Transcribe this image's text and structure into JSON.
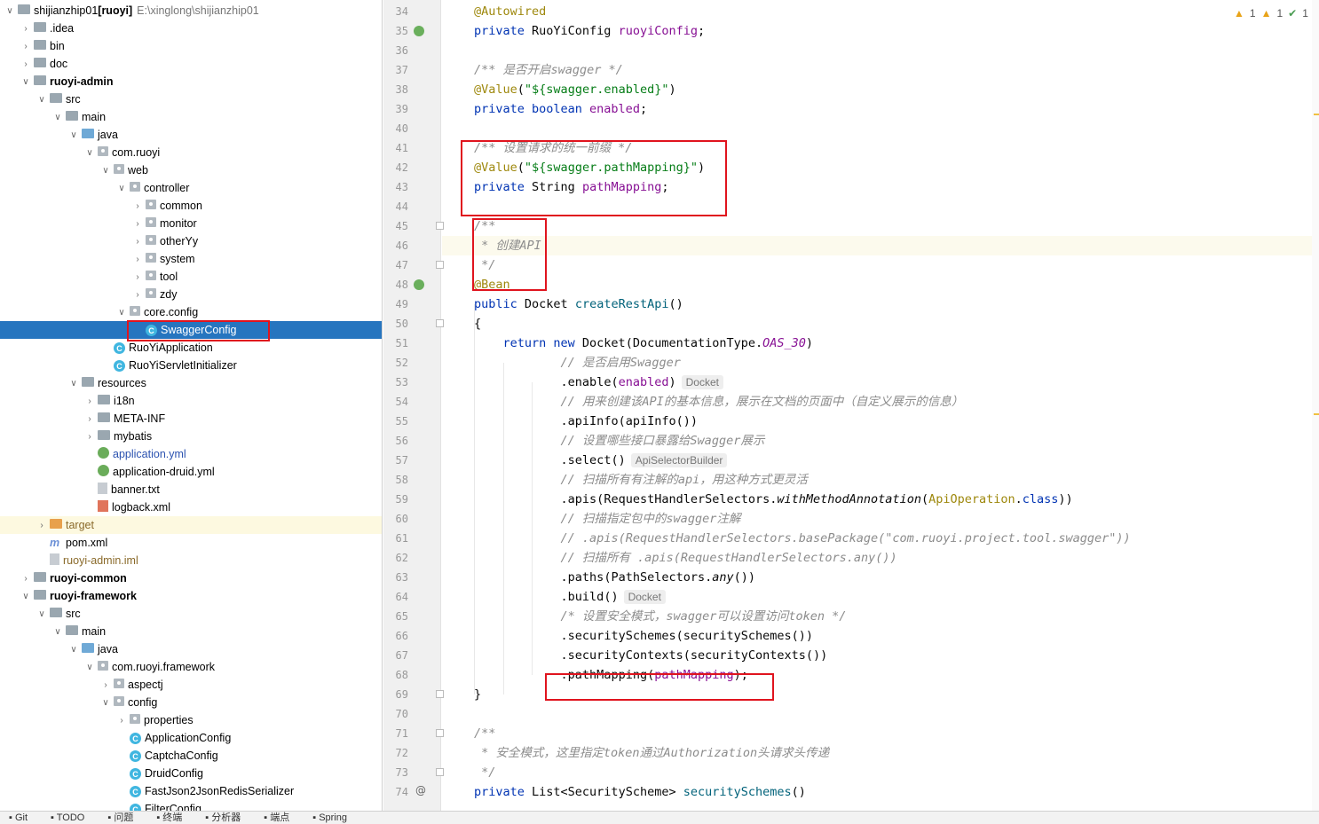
{
  "project_tree": {
    "root": {
      "name": "shijianzhip01",
      "tag": "[ruoyi]",
      "path": "E:\\xinglong\\shijianzhip01"
    },
    "items": [
      {
        "label": ".idea",
        "kind": "folder"
      },
      {
        "label": "bin",
        "kind": "folder"
      },
      {
        "label": "doc",
        "kind": "folder"
      },
      {
        "label": "ruoyi-admin",
        "kind": "module"
      },
      {
        "label": "src",
        "kind": "folder"
      },
      {
        "label": "main",
        "kind": "folder"
      },
      {
        "label": "java",
        "kind": "folder"
      },
      {
        "label": "com.ruoyi",
        "kind": "package"
      },
      {
        "label": "web",
        "kind": "package"
      },
      {
        "label": "controller",
        "kind": "package"
      },
      {
        "label": "common",
        "kind": "package"
      },
      {
        "label": "monitor",
        "kind": "package"
      },
      {
        "label": "otherYy",
        "kind": "package"
      },
      {
        "label": "system",
        "kind": "package"
      },
      {
        "label": "tool",
        "kind": "package"
      },
      {
        "label": "zdy",
        "kind": "package"
      },
      {
        "label": "core.config",
        "kind": "package"
      },
      {
        "label": "SwaggerConfig",
        "kind": "class"
      },
      {
        "label": "RuoYiApplication",
        "kind": "class"
      },
      {
        "label": "RuoYiServletInitializer",
        "kind": "class"
      },
      {
        "label": "resources",
        "kind": "folder"
      },
      {
        "label": "i18n",
        "kind": "folder"
      },
      {
        "label": "META-INF",
        "kind": "folder"
      },
      {
        "label": "mybatis",
        "kind": "folder"
      },
      {
        "label": "application.yml",
        "kind": "yml"
      },
      {
        "label": "application-druid.yml",
        "kind": "yml"
      },
      {
        "label": "banner.txt",
        "kind": "file"
      },
      {
        "label": "logback.xml",
        "kind": "xml"
      },
      {
        "label": "target",
        "kind": "folder"
      },
      {
        "label": "pom.xml",
        "kind": "maven"
      },
      {
        "label": "ruoyi-admin.iml",
        "kind": "file"
      },
      {
        "label": "ruoyi-common",
        "kind": "module"
      },
      {
        "label": "ruoyi-framework",
        "kind": "module"
      },
      {
        "label": "src",
        "kind": "folder"
      },
      {
        "label": "main",
        "kind": "folder"
      },
      {
        "label": "java",
        "kind": "folder"
      },
      {
        "label": "com.ruoyi.framework",
        "kind": "package"
      },
      {
        "label": "aspectj",
        "kind": "package"
      },
      {
        "label": "config",
        "kind": "package"
      },
      {
        "label": "properties",
        "kind": "package"
      },
      {
        "label": "ApplicationConfig",
        "kind": "class"
      },
      {
        "label": "CaptchaConfig",
        "kind": "class"
      },
      {
        "label": "DruidConfig",
        "kind": "class"
      },
      {
        "label": "FastJson2JsonRedisSerializer",
        "kind": "class"
      },
      {
        "label": "FilterConfig",
        "kind": "class"
      }
    ]
  },
  "inspection": {
    "warnings_a": "1",
    "warnings_b": "1",
    "ok": "1"
  },
  "editor": {
    "line_numbers": [
      "34",
      "35",
      "36",
      "37",
      "38",
      "39",
      "40",
      "41",
      "42",
      "43",
      "44",
      "45",
      "46",
      "47",
      "48",
      "49",
      "50",
      "51",
      "52",
      "53",
      "54",
      "55",
      "56",
      "57",
      "58",
      "59",
      "60",
      "61",
      "62",
      "63",
      "64",
      "65",
      "66",
      "67",
      "68",
      "69",
      "70",
      "71",
      "72",
      "73",
      "74"
    ],
    "hints": {
      "docket": "Docket",
      "api_selector": "ApiSelectorBuilder"
    },
    "tokens": {
      "l34_a": "@Autowired",
      "l35_kw": "private ",
      "l35_t": "RuoYiConfig ",
      "l35_f": "ruoyiConfig",
      "l35_e": ";",
      "l37": "/** 是否开启swagger */",
      "l38_a": "@Value",
      "l38_p": "(",
      "l38_s": "\"${swagger.enabled}\"",
      "l38_e": ")",
      "l39_kw": "private boolean ",
      "l39_f": "enabled",
      "l39_e": ";",
      "l41": "/** 设置请求的统一前缀 */",
      "l42_a": "@Value",
      "l42_p": "(",
      "l42_s": "\"${swagger.pathMapping}\"",
      "l42_e": ")",
      "l43_kw": "private ",
      "l43_t": "String ",
      "l43_f": "pathMapping",
      "l43_e": ";",
      "l45": "/**",
      "l46": " * 创建API",
      "l47": " */",
      "l48": "@Bean",
      "l49_kw": "public ",
      "l49_t": "Docket ",
      "l49_m": "createRestApi",
      "l49_e": "()",
      "l50": "{",
      "l51_kw": "return new ",
      "l51_t": "Docket(DocumentationType.",
      "l51_f": "OAS_30",
      "l51_e": ")",
      "l52": "// 是否启用Swagger",
      "l53_t": ".enable(",
      "l53_f": "enabled",
      "l53_e": ")",
      "l54": "// 用来创建该API的基本信息，展示在文档的页面中（自定义展示的信息）",
      "l55": ".apiInfo(apiInfo())",
      "l56": "// 设置哪些接口暴露给Swagger展示",
      "l57": ".select()",
      "l58": "// 扫描所有有注解的api，用这种方式更灵活",
      "l59_t": ".apis(RequestHandlerSelectors.",
      "l59_i": "withMethodAnnotation",
      "l59_p": "(",
      "l59_a": "ApiOperation",
      "l59_d": ".",
      "l59_k": "class",
      "l59_e": "))",
      "l60": "// 扫描指定包中的swagger注解",
      "l61": "// .apis(RequestHandlerSelectors.basePackage(\"com.ruoyi.project.tool.swagger\"))",
      "l62": "// 扫描所有 .apis(RequestHandlerSelectors.any())",
      "l63_t": ".paths(PathSelectors.",
      "l63_i": "any",
      "l63_e": "())",
      "l64": ".build()",
      "l65": "/* 设置安全模式，swagger可以设置访问token */",
      "l66": ".securitySchemes(securitySchemes())",
      "l67": ".securityContexts(securityContexts())",
      "l68_t": ".pathMapping(",
      "l68_f": "pathMapping",
      "l68_e": ");",
      "l69": "}",
      "l71": "/**",
      "l72": " * 安全模式，这里指定token通过Authorization头请求头传递",
      "l73": " */",
      "l74_kw": "private ",
      "l74_t": "List<SecurityScheme> ",
      "l74_m": "securitySchemes",
      "l74_e": "()"
    }
  },
  "bottom_tabs": [
    "Git",
    "TODO",
    "问题",
    "终端",
    "分析器",
    "端点",
    "Spring"
  ],
  "colors": {
    "selection": "#2675bf",
    "keyword": "#0033b3",
    "annotation": "#9e880d",
    "string": "#067d17",
    "field": "#871094",
    "comment": "#8c8c8c",
    "callout": "#e0141e"
  }
}
